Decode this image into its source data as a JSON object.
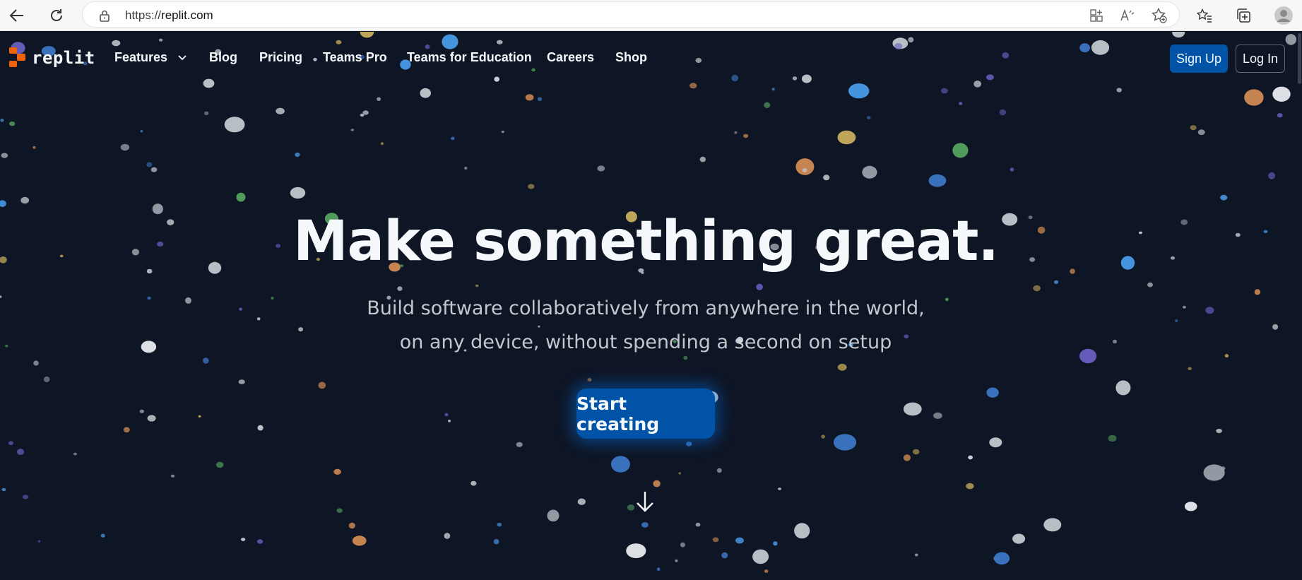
{
  "browser": {
    "url_scheme": "https://",
    "url_host": "replit.com",
    "back_icon": "back-arrow-icon",
    "refresh_icon": "refresh-icon",
    "lock_icon": "lock-icon"
  },
  "site": {
    "logo_text": "replit",
    "brand_color": "#f26207",
    "nav": {
      "features": "Features",
      "blog": "Blog",
      "pricing": "Pricing",
      "teams_pro": "Teams Pro",
      "teams_education": "Teams for Education",
      "careers": "Careers",
      "shop": "Shop"
    },
    "signup": "Sign Up",
    "login": "Log In"
  },
  "hero": {
    "title": "Make something great.",
    "subtitle_line1": "Build software collaboratively from anywhere in the world,",
    "subtitle_line2": "on any device, without spending a second on setup",
    "cta": "Start creating"
  },
  "colors": {
    "background": "#0e1525",
    "primary_button": "#0053a6",
    "text": "#f5f9fc"
  }
}
